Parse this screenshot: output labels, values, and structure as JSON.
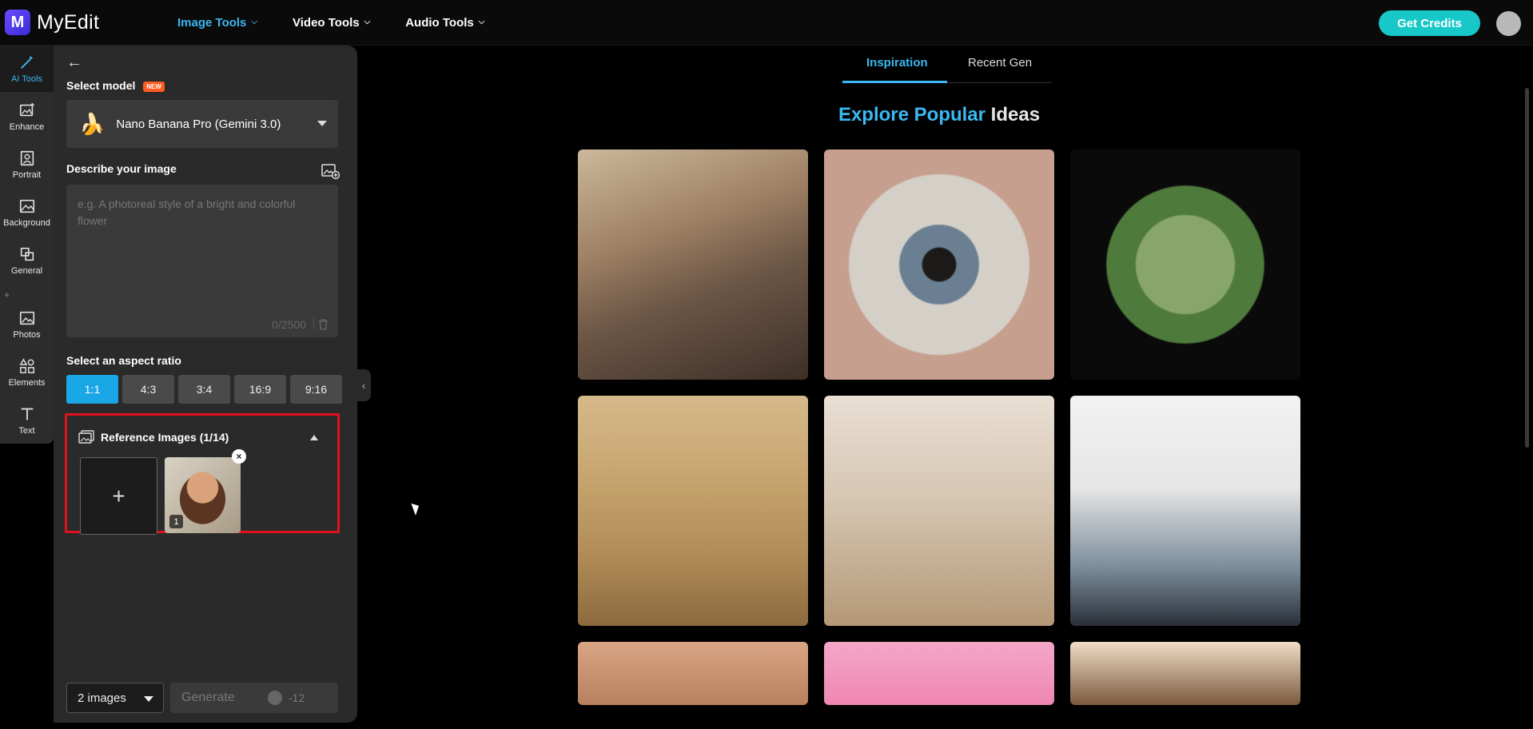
{
  "app": {
    "logo_letter": "M",
    "name": "MyEdit"
  },
  "topnav": {
    "items": [
      {
        "label": "Image Tools",
        "active": true
      },
      {
        "label": "Video Tools",
        "active": false
      },
      {
        "label": "Audio Tools",
        "active": false
      }
    ],
    "get_credits": "Get Credits"
  },
  "rail": {
    "items": [
      {
        "label": "AI Tools",
        "icon": "magic-wand-icon",
        "active": true
      },
      {
        "label": "Enhance",
        "icon": "enhance-icon"
      },
      {
        "label": "Portrait",
        "icon": "portrait-icon"
      },
      {
        "label": "Background",
        "icon": "background-icon"
      },
      {
        "label": "General",
        "icon": "general-icon"
      },
      {
        "label": "Photos",
        "icon": "photos-icon"
      },
      {
        "label": "Elements",
        "icon": "elements-icon"
      },
      {
        "label": "Text",
        "icon": "text-icon"
      }
    ]
  },
  "panel": {
    "select_model_label": "Select model",
    "new_badge": "NEW",
    "model_value": "Nano Banana Pro (Gemini 3.0)",
    "describe_label": "Describe your image",
    "prompt_placeholder": "e.g. A photoreal style of a bright and colorful flower",
    "char_count": "0/2500",
    "aspect_label": "Select an aspect ratio",
    "aspect_ratios": [
      "1:1",
      "4:3",
      "3:4",
      "16:9",
      "9:16"
    ],
    "aspect_selected": "1:1",
    "reference_label": "Reference Images (1/14)",
    "reference_thumb_number": "1",
    "image_count": "2 images",
    "generate_label": "Generate",
    "generate_cost": "-12"
  },
  "main": {
    "tabs": [
      {
        "label": "Inspiration",
        "active": true
      },
      {
        "label": "Recent Gen",
        "active": false
      }
    ],
    "heading_part1": "Explore Popular",
    "heading_part2": "Ideas"
  },
  "colors": {
    "accent": "#3bb8f2",
    "credits": "#18c8c8",
    "highlight_border": "#e1121f"
  }
}
